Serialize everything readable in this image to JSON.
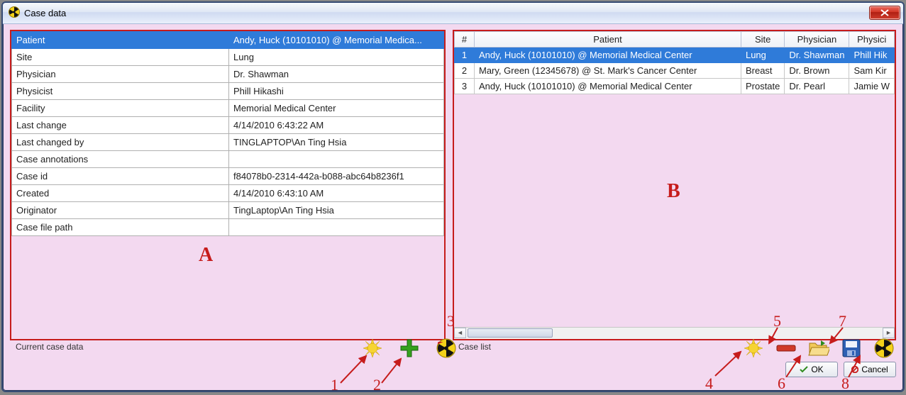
{
  "window": {
    "title": "Case data"
  },
  "left_panel": {
    "section_label": "Current case data",
    "letter": "A",
    "rows": [
      {
        "key": "Patient",
        "value": "Andy, Huck (10101010) @ Memorial Medica...",
        "selected": true
      },
      {
        "key": "Site",
        "value": "Lung"
      },
      {
        "key": "Physician",
        "value": "Dr. Shawman"
      },
      {
        "key": "Physicist",
        "value": "Phill Hikashi"
      },
      {
        "key": "Facility",
        "value": "Memorial Medical Center"
      },
      {
        "key": "Last change",
        "value": "4/14/2010 6:43:22 AM"
      },
      {
        "key": "Last changed by",
        "value": "TINGLAPTOP\\An Ting Hsia"
      },
      {
        "key": "Case annotations",
        "value": ""
      },
      {
        "key": "Case id",
        "value": "f84078b0-2314-442a-b088-abc64b8236f1"
      },
      {
        "key": "Created",
        "value": "4/14/2010 6:43:10 AM"
      },
      {
        "key": "Originator",
        "value": "TingLaptop\\An Ting Hsia"
      },
      {
        "key": "Case file path",
        "value": ""
      }
    ]
  },
  "right_panel": {
    "section_label": "Case list",
    "letter": "B",
    "headers": {
      "num": "#",
      "patient": "Patient",
      "site": "Site",
      "physician": "Physician",
      "physicist": "Physici"
    },
    "rows": [
      {
        "num": "1",
        "patient": "Andy, Huck (10101010) @ Memorial Medical Center",
        "site": "Lung",
        "physician": "Dr. Shawman",
        "physicist": "Phill Hik",
        "selected": true
      },
      {
        "num": "2",
        "patient": "Mary, Green (12345678) @ St. Mark's Cancer Center",
        "site": "Breast",
        "physician": "Dr. Brown",
        "physicist": "Sam Kir"
      },
      {
        "num": "3",
        "patient": "Andy, Huck (10101010) @ Memorial Medical Center",
        "site": "Prostate",
        "physician": "Dr. Pearl",
        "physicist": "Jamie W"
      }
    ]
  },
  "buttons": {
    "ok": "OK",
    "cancel": "Cancel"
  },
  "annotations": {
    "n1": "1",
    "n2": "2",
    "n3": "3",
    "n4": "4",
    "n5": "5",
    "n6": "6",
    "n7": "7",
    "n8": "8"
  }
}
